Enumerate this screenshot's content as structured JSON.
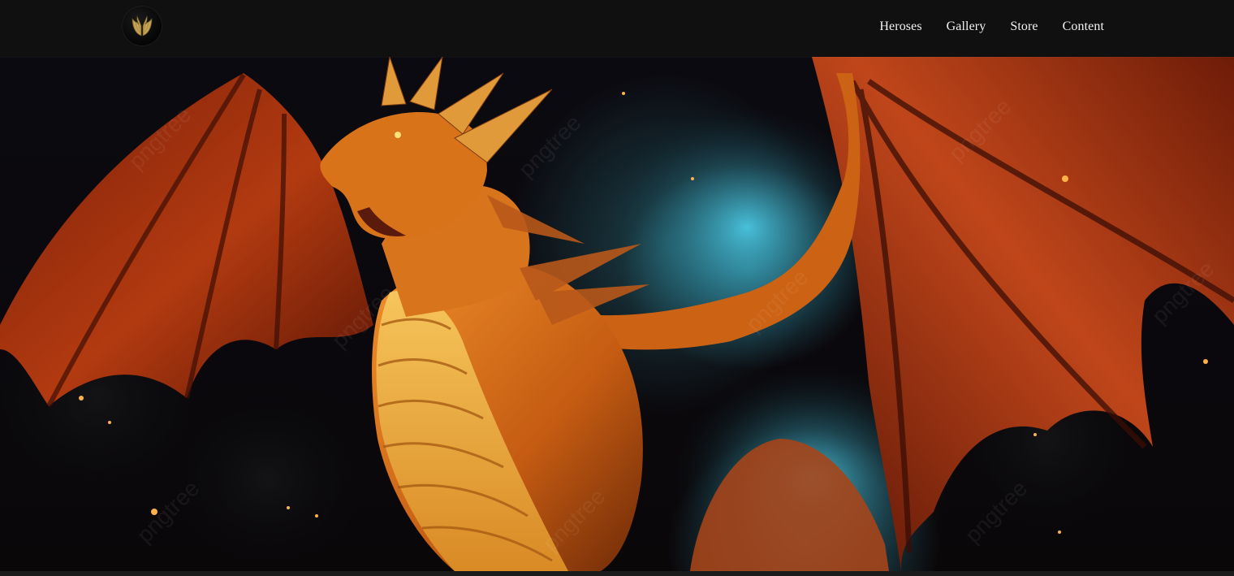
{
  "header": {
    "logo_icon": "golden-wings-icon",
    "nav": [
      {
        "label": "Heroses"
      },
      {
        "label": "Gallery"
      },
      {
        "label": "Store"
      },
      {
        "label": "Content"
      }
    ]
  },
  "hero": {
    "image_subject": "dragon-illustration",
    "watermark": "pngtree",
    "colors": {
      "wing": "#b23a10",
      "body": "#d9781a",
      "belly": "#f0b545",
      "smoke": "#3ac3e0",
      "background": "#0a0709"
    }
  }
}
